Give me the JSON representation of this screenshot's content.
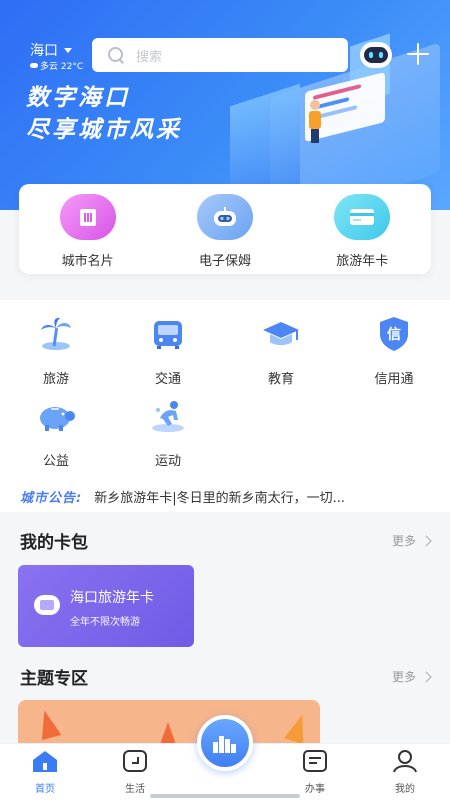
{
  "header": {
    "city": "海口",
    "weather": "多云 22°C",
    "search_placeholder": "搜索"
  },
  "banner": {
    "line1": "数字海口",
    "line2": "尽享城市风采"
  },
  "top_services": [
    {
      "label": "城市名片",
      "icon": "building-icon",
      "color": "#e86cf0"
    },
    {
      "label": "电子保姆",
      "icon": "robot-icon",
      "color": "#7fb2f5"
    },
    {
      "label": "旅游年卡",
      "icon": "card-icon",
      "color": "#55d4ee"
    }
  ],
  "services": [
    {
      "label": "旅游",
      "icon": "palm-tree-icon"
    },
    {
      "label": "交通",
      "icon": "bus-icon"
    },
    {
      "label": "教育",
      "icon": "graduation-cap-icon"
    },
    {
      "label": "信用通",
      "icon": "shield-icon",
      "glyph": "信"
    },
    {
      "label": "公益",
      "icon": "piggy-bank-icon"
    },
    {
      "label": "运动",
      "icon": "running-icon"
    }
  ],
  "notice": {
    "tag": "城市公告:",
    "text": "新乡旅游年卡|冬日里的新乡南太行，一切..."
  },
  "card_pack": {
    "title": "我的卡包",
    "more": "更多",
    "card": {
      "name": "海口旅游年卡",
      "subtitle": "全年不限次畅游"
    }
  },
  "theme": {
    "title": "主题专区",
    "more": "更多"
  },
  "tabbar": [
    {
      "label": "首页",
      "icon": "home-icon",
      "active": true
    },
    {
      "label": "生活",
      "icon": "life-icon",
      "active": false
    },
    {
      "label": "办事",
      "icon": "tasks-icon",
      "active": false
    },
    {
      "label": "我的",
      "icon": "profile-icon",
      "active": false
    }
  ],
  "colors": {
    "primary": "#3a7cf4",
    "card": "#7b66ec"
  }
}
